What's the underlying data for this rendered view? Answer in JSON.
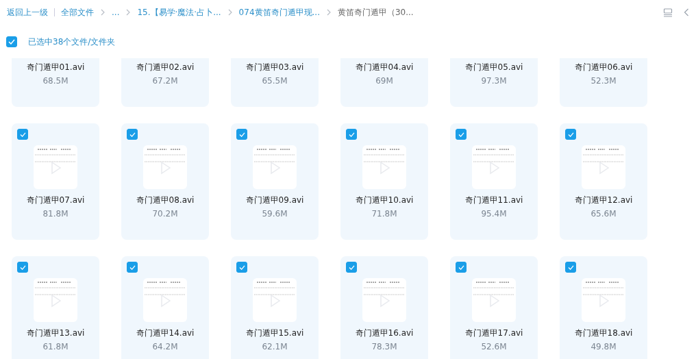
{
  "breadcrumb": {
    "back": "返回上一级",
    "items": [
      {
        "label": "全部文件",
        "current": false
      },
      {
        "label": "...",
        "current": false
      },
      {
        "label": "15.【易学·魔法·占卜...",
        "current": false
      },
      {
        "label": "074黄笛奇门遁甲现...",
        "current": false
      },
      {
        "label": "黄笛奇门遁甲（30...",
        "current": true
      }
    ]
  },
  "selection": {
    "checked": true,
    "label": "已选中38个文件/文件夹"
  },
  "files": [
    {
      "name": "奇门遁甲01.avi",
      "size": "68.5M",
      "selected": true
    },
    {
      "name": "奇门遁甲02.avi",
      "size": "67.2M",
      "selected": true
    },
    {
      "name": "奇门遁甲03.avi",
      "size": "65.5M",
      "selected": true
    },
    {
      "name": "奇门遁甲04.avi",
      "size": "69M",
      "selected": true
    },
    {
      "name": "奇门遁甲05.avi",
      "size": "97.3M",
      "selected": true
    },
    {
      "name": "奇门遁甲06.avi",
      "size": "52.3M",
      "selected": true
    },
    {
      "name": "奇门遁甲07.avi",
      "size": "81.8M",
      "selected": true
    },
    {
      "name": "奇门遁甲08.avi",
      "size": "70.2M",
      "selected": true
    },
    {
      "name": "奇门遁甲09.avi",
      "size": "59.6M",
      "selected": true
    },
    {
      "name": "奇门遁甲10.avi",
      "size": "71.8M",
      "selected": true
    },
    {
      "name": "奇门遁甲11.avi",
      "size": "95.4M",
      "selected": true
    },
    {
      "name": "奇门遁甲12.avi",
      "size": "65.6M",
      "selected": true
    },
    {
      "name": "奇门遁甲13.avi",
      "size": "61.8M",
      "selected": true
    },
    {
      "name": "奇门遁甲14.avi",
      "size": "64.2M",
      "selected": true
    },
    {
      "name": "奇门遁甲15.avi",
      "size": "62.1M",
      "selected": true
    },
    {
      "name": "奇门遁甲16.avi",
      "size": "78.3M",
      "selected": true
    },
    {
      "name": "奇门遁甲17.avi",
      "size": "52.6M",
      "selected": true
    },
    {
      "name": "奇门遁甲18.avi",
      "size": "49.8M",
      "selected": true
    }
  ]
}
